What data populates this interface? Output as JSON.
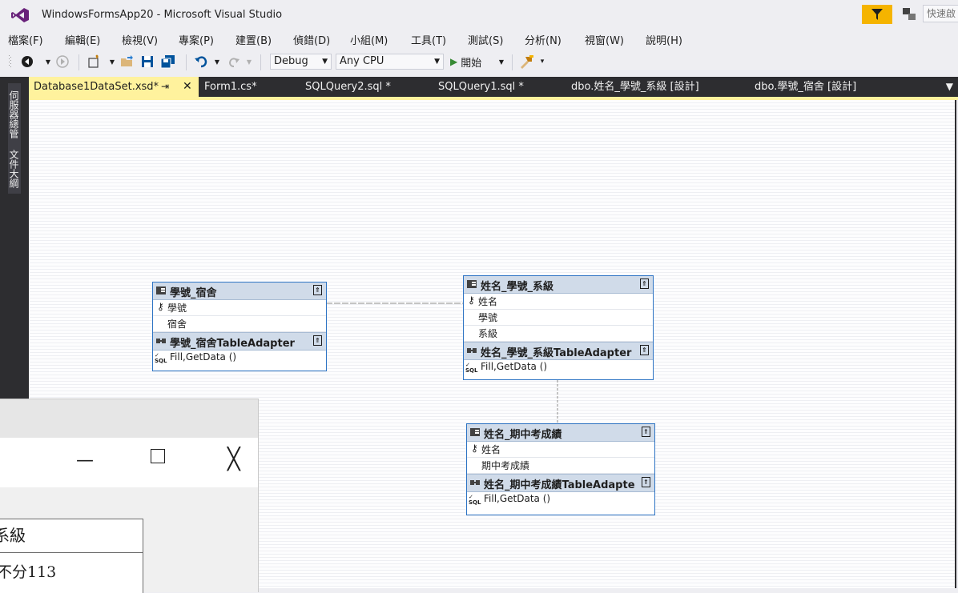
{
  "window": {
    "title": "WindowsFormsApp20 - Microsoft Visual Studio",
    "quick_launch": "快速啟"
  },
  "menu": [
    "檔案(F)",
    "編輯(E)",
    "檢視(V)",
    "專案(P)",
    "建置(B)",
    "偵錯(D)",
    "小組(M)",
    "工具(T)",
    "測試(S)",
    "分析(N)",
    "視窗(W)",
    "說明(H)"
  ],
  "toolbar": {
    "config": "Debug",
    "platform": "Any CPU",
    "start_label": "開始"
  },
  "side_rail": [
    "伺服器總管",
    "文件大綱"
  ],
  "tabs": [
    "Database1DataSet.xsd*",
    "Form1.cs*",
    "SQLQuery2.sql *",
    "SQLQuery1.sql *",
    "dbo.姓名_學號_系級 [設計]",
    "dbo.學號_宿舍 [設計]"
  ],
  "tables": [
    {
      "name": "學號_宿舍",
      "columns": [
        "學號",
        "宿舍"
      ],
      "adapter": "學號_宿舍TableAdapter",
      "query": "Fill,GetData ()"
    },
    {
      "name": "姓名_學號_系級",
      "columns": [
        "姓名",
        "學號",
        "系級"
      ],
      "adapter": "姓名_學號_系級TableAdapter",
      "query": "Fill,GetData ()"
    },
    {
      "name": "姓名_期中考成績",
      "columns": [
        "姓名",
        "期中考成績"
      ],
      "adapter": "姓名_期中考成績TableAdapte",
      "query": "Fill,GetData ()"
    }
  ],
  "form_window": {
    "grid_header": "系級",
    "grid_cell": "不分113"
  },
  "colors": {
    "active_tab": "#fff29d",
    "dark_chrome": "#2d2d30",
    "table_border": "#2e74c4",
    "table_header": "#d0dbe9",
    "filter_button": "#f5b400"
  }
}
